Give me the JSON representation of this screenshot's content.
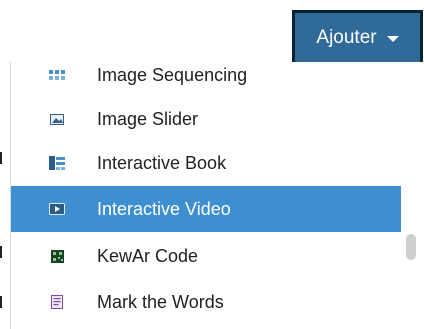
{
  "add_button": {
    "label": "Ajouter"
  },
  "menu": {
    "items": [
      {
        "label": "Image Sequencing",
        "icon": "image-sequencing-icon"
      },
      {
        "label": "Image Slider",
        "icon": "image-slider-icon"
      },
      {
        "label": "Interactive Book",
        "icon": "interactive-book-icon"
      },
      {
        "label": "Interactive Video",
        "icon": "interactive-video-icon"
      },
      {
        "label": "KewAr Code",
        "icon": "kewar-code-icon"
      },
      {
        "label": "Mark the Words",
        "icon": "mark-the-words-icon"
      }
    ],
    "selected": "Interactive Video"
  },
  "colors": {
    "button_bg": "#2f6a99",
    "button_border": "#0b2233",
    "active_bg": "#3d8fd1"
  }
}
